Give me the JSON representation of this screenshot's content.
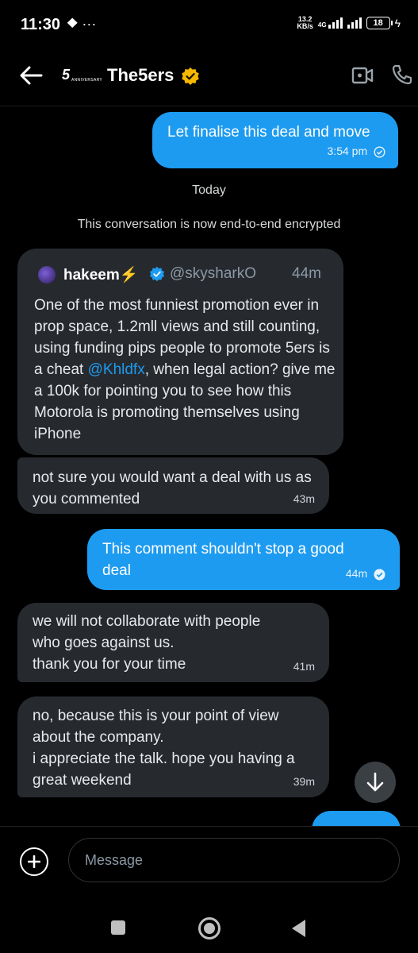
{
  "status_bar": {
    "time": "11:30",
    "left_icons": "⯁ ···",
    "net_speed_value": "13.2",
    "net_speed_unit": "KB/s",
    "network_label": "4G",
    "battery": "18"
  },
  "header": {
    "logo_number": "5",
    "logo_sub": "ANNIVERSARY",
    "title": "The5ers",
    "colors": {
      "verified_gold": "#f5b800",
      "accent": "#1d9bf0"
    }
  },
  "messages": [
    {
      "id": "m1",
      "direction": "out",
      "text": "Let finalise this deal and move",
      "time": "3:54 pm"
    },
    {
      "id": "m2",
      "direction": "in",
      "text": "not sure you would want a deal with us as you commented",
      "time": "43m"
    },
    {
      "id": "m3",
      "direction": "out",
      "text": "This comment shouldn't stop a good deal",
      "time": "44m"
    },
    {
      "id": "m4",
      "direction": "in",
      "lines": [
        "we will not collaborate with people",
        "who goes against us.",
        "thank you for your time"
      ],
      "time": "41m"
    },
    {
      "id": "m5",
      "direction": "in",
      "lines": [
        "no, because this is your point of view",
        "about the company.",
        "i appreciate the talk. hope you having a",
        "great weekend"
      ],
      "time": "39m"
    }
  ],
  "divider": {
    "date": "Today",
    "encryption_notice": "This conversation is now end-to-end encrypted"
  },
  "quoted_post": {
    "name": "hakeem",
    "name_emoji": "⚡",
    "handle": "@skysharkO",
    "time": "44m",
    "body_before": "One of the most funniest promotion ever in prop space, 1.2mll views and still counting, using funding pips people to promote 5ers is a cheat ",
    "mention": "@Khldfx",
    "body_after": ", when legal action? give me a 100k for pointing you to see how this Motorola is promoting themselves using iPhone"
  },
  "composer": {
    "placeholder": "Message"
  }
}
